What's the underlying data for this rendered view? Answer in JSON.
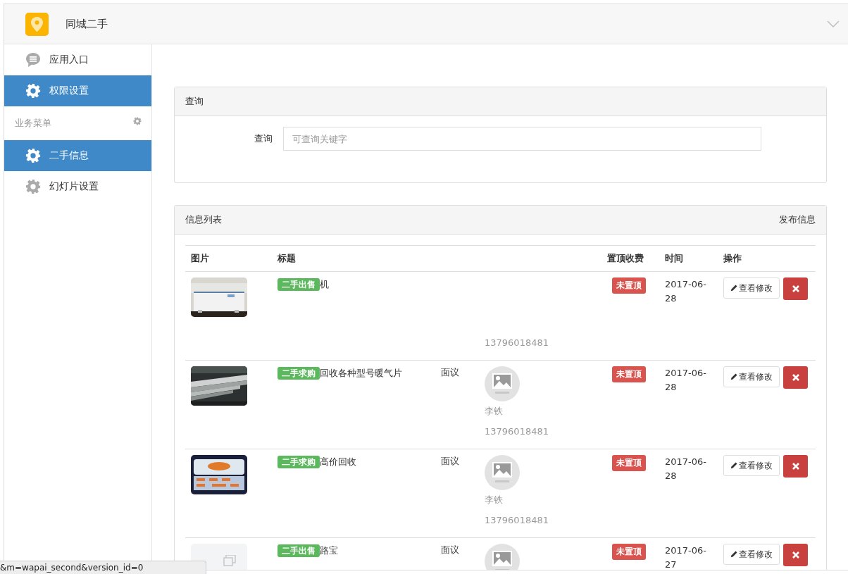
{
  "app": {
    "title": "同城二手"
  },
  "sidebar": {
    "items": [
      {
        "label": "应用入口",
        "selected": false
      },
      {
        "label": "权限设置",
        "selected": true
      }
    ],
    "section": {
      "title": "业务菜单",
      "items": [
        {
          "label": "二手信息",
          "selected": true
        },
        {
          "label": "幻灯片设置",
          "selected": false
        }
      ]
    }
  },
  "query_panel": {
    "title": "查询",
    "field_label": "查询",
    "placeholder": "可查询关键字"
  },
  "list_panel": {
    "title": "信息列表",
    "action": "发布信息",
    "columns": {
      "column_1": "图片",
      "column_2": "标题",
      "column_5": "置顶收费",
      "column_6": "时间",
      "column_7": "操作"
    },
    "rows": [
      {
        "kind": "picture",
        "tag": "二手出售",
        "title": "机",
        "phone": "13796018481",
        "pin": "未置顶",
        "time": "2017-06-28",
        "edit": "查看修改"
      },
      {
        "kind": "picture",
        "tag": "二手求购",
        "title": "回收各种型号暖气片",
        "price": "面议",
        "avatar": true,
        "name": "李铁",
        "phone": "13796018481",
        "pin": "未置顶",
        "time": "2017-06-28",
        "edit": "查看修改"
      },
      {
        "kind": "picture",
        "tag": "二手求购",
        "title": "高价回收",
        "price": "面议",
        "avatar": true,
        "name": "李铁",
        "phone": "13796018481",
        "pin": "未置顶",
        "time": "2017-06-28",
        "edit": "查看修改"
      },
      {
        "kind": "placeholder",
        "tag": "二手出售",
        "title": "路宝",
        "price": "面议",
        "avatar": true,
        "pin": "未置顶",
        "time": "2017-06-27",
        "edit": "查看修改"
      }
    ]
  },
  "status_url": "&m=wapai_second&version_id=0"
}
